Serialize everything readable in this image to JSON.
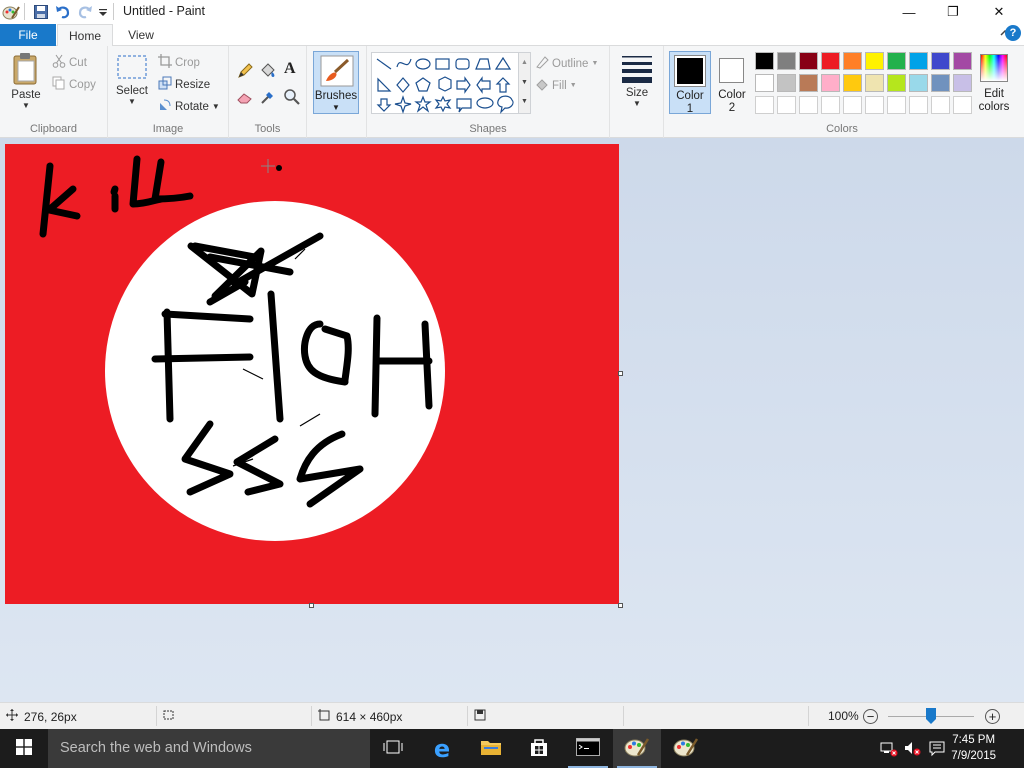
{
  "window": {
    "title": "Untitled - Paint",
    "minimize_glyph": "—",
    "maximize_glyph": "❐",
    "close_glyph": "✕"
  },
  "tabs": {
    "file": "File",
    "home": "Home",
    "view": "View"
  },
  "clipboard": {
    "paste": "Paste",
    "cut": "Cut",
    "copy": "Copy",
    "label": "Clipboard"
  },
  "image": {
    "select": "Select",
    "crop": "Crop",
    "resize": "Resize",
    "rotate": "Rotate",
    "label": "Image"
  },
  "tools": {
    "label": "Tools"
  },
  "brushes": {
    "label": "Brushes"
  },
  "shapes": {
    "outline": "Outline",
    "fill": "Fill",
    "label": "Shapes"
  },
  "size": {
    "label": "Size"
  },
  "color1": {
    "label1": "Color",
    "label2": "1"
  },
  "color2": {
    "label1": "Color",
    "label2": "2"
  },
  "colors": {
    "label": "Colors",
    "edit1": "Edit",
    "edit2": "colors",
    "row1": [
      "#000000",
      "#7f7f7f",
      "#880015",
      "#ed1c24",
      "#ff7f27",
      "#fff200",
      "#22b14c",
      "#00a2e8",
      "#3f48cc",
      "#a349a4"
    ],
    "row2": [
      "#ffffff",
      "#c3c3c3",
      "#b97a57",
      "#ffaec9",
      "#ffc90e",
      "#efe4b0",
      "#b5e61d",
      "#99d9ea",
      "#7092be",
      "#c8bfe7"
    ],
    "color1_value": "#000000",
    "color2_value": "#ffffff"
  },
  "canvas": {
    "background": "#ed1c24",
    "circle": "#ffffff",
    "ink": "#000000"
  },
  "status": {
    "cursor_pos": "276, 26px",
    "image_size": "614 × 460px",
    "zoom": "100%",
    "zoom_level": 0.5
  },
  "taskbar": {
    "search_placeholder": "Search the web and Windows",
    "time": "7:45 PM",
    "date": "7/9/2015"
  }
}
